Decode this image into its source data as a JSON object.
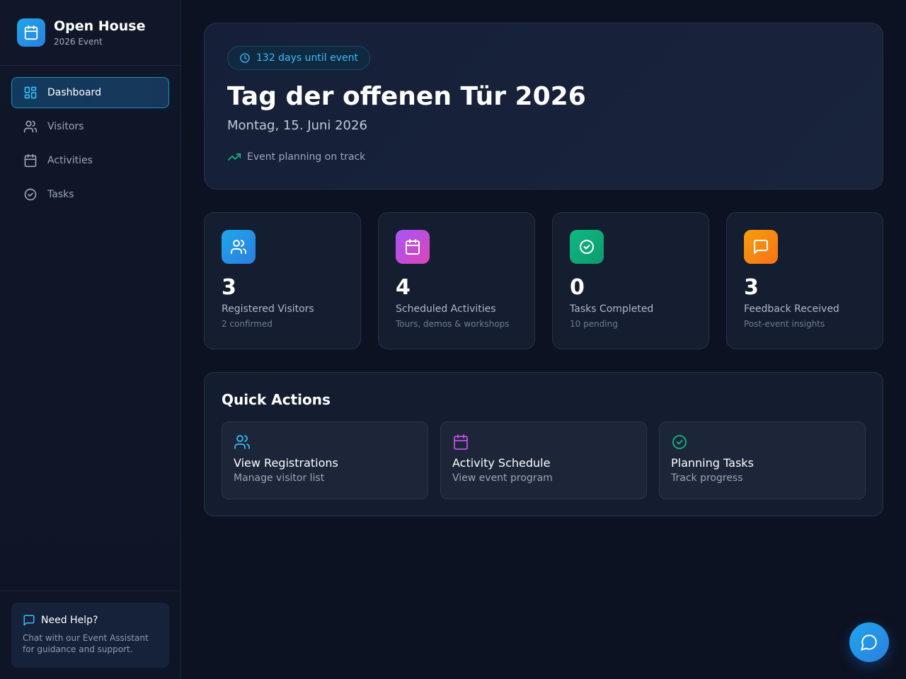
{
  "brand": {
    "title": "Open House",
    "subtitle": "2026 Event",
    "icon": "calendar-icon"
  },
  "sidebar": {
    "items": [
      {
        "label": "Dashboard",
        "icon": "grid-icon",
        "active": true
      },
      {
        "label": "Visitors",
        "icon": "users-icon",
        "active": false
      },
      {
        "label": "Activities",
        "icon": "calendar-icon",
        "active": false
      },
      {
        "label": "Tasks",
        "icon": "check-circle-icon",
        "active": false
      }
    ],
    "help": {
      "title": "Need Help?",
      "text": "Chat with our Event Assistant for guidance and support.",
      "icon": "chat-icon"
    }
  },
  "hero": {
    "countdown": "132 days until event",
    "title": "Tag der offenen Tür 2026",
    "date": "Montag, 15. Juni 2026",
    "status": "Event planning on track"
  },
  "stats": [
    {
      "value": "3",
      "label": "Registered Visitors",
      "sub": "2 confirmed",
      "icon": "users-icon",
      "color": "#2196f3"
    },
    {
      "value": "4",
      "label": "Scheduled Activities",
      "sub": "Tours, demos & workshops",
      "icon": "calendar-icon",
      "color": "#c040d8"
    },
    {
      "value": "0",
      "label": "Tasks Completed",
      "sub": "10 pending",
      "icon": "check-circle-icon",
      "color": "#10a56a"
    },
    {
      "value": "3",
      "label": "Feedback Received",
      "sub": "Post-event insights",
      "icon": "message-square-icon",
      "color": "#f07a10"
    }
  ],
  "quick_actions": {
    "title": "Quick Actions",
    "items": [
      {
        "title": "View Registrations",
        "sub": "Manage visitor list",
        "icon": "users-icon",
        "color": "#38bdf8"
      },
      {
        "title": "Activity Schedule",
        "sub": "View event program",
        "icon": "calendar-icon",
        "color": "#c050e8"
      },
      {
        "title": "Planning Tasks",
        "sub": "Track progress",
        "icon": "check-circle-icon",
        "color": "#10b981"
      }
    ]
  },
  "colors": {
    "accent": "#38bdf8",
    "success": "#10b981",
    "background": "#0c1222"
  }
}
